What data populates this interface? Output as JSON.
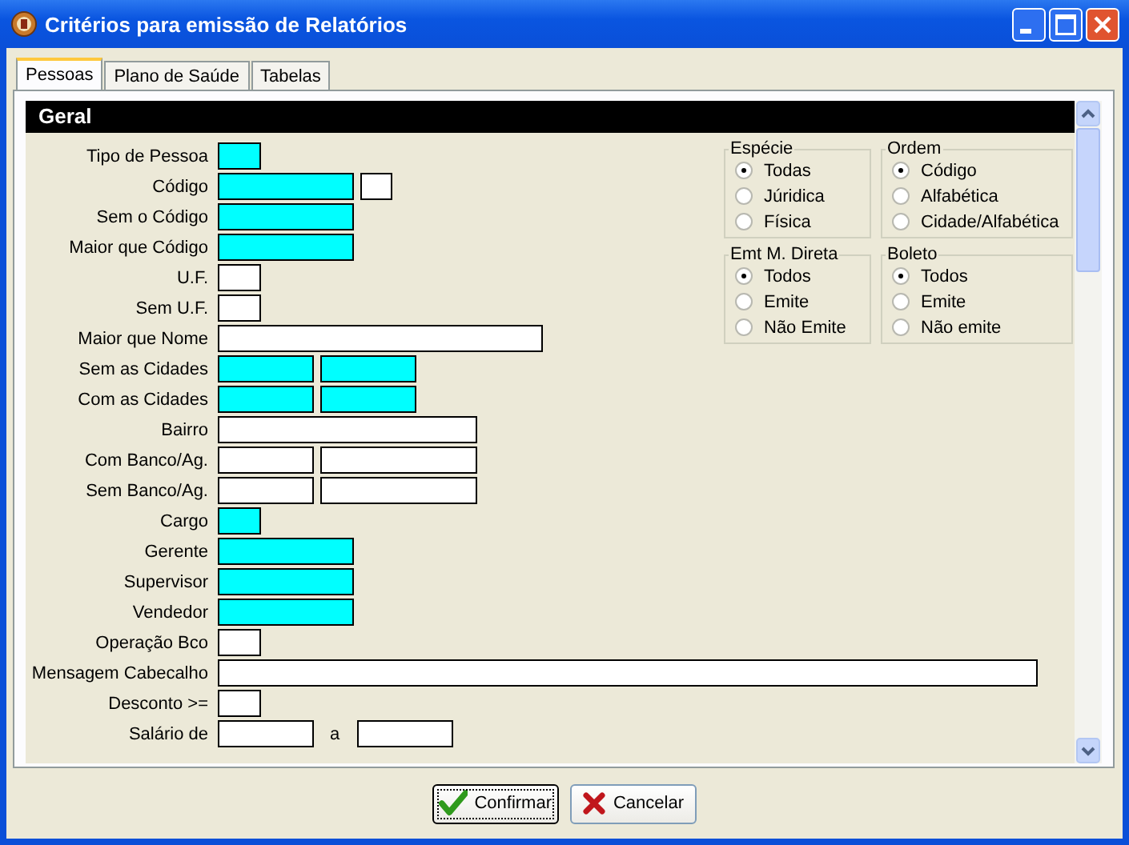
{
  "window": {
    "title": "Critérios para emissão de Relatórios"
  },
  "tabs": [
    {
      "label": "Pessoas",
      "selected": true
    },
    {
      "label": "Plano de Saúde",
      "selected": false
    },
    {
      "label": "Tabelas",
      "selected": false
    }
  ],
  "section": {
    "title": "Geral"
  },
  "rows": [
    {
      "label": "Tipo de Pessoa",
      "fields": [
        {
          "kind": "short",
          "color": "#00ffff"
        }
      ]
    },
    {
      "label": "Código",
      "fields": [
        {
          "kind": "code",
          "color": "#00ffff"
        },
        {
          "kind": "tiny",
          "color": "#ffffff"
        }
      ]
    },
    {
      "label": "Sem o Código",
      "fields": [
        {
          "kind": "code",
          "color": "#00ffff"
        }
      ]
    },
    {
      "label": "Maior que Código",
      "fields": [
        {
          "kind": "code",
          "color": "#00ffff"
        }
      ]
    },
    {
      "label": "U.F.",
      "fields": [
        {
          "kind": "short",
          "color": "#ffffff"
        }
      ]
    },
    {
      "label": "Sem U.F.",
      "fields": [
        {
          "kind": "short",
          "color": "#ffffff"
        }
      ]
    },
    {
      "label": "Maior que Nome",
      "fields": [
        {
          "kind": "long",
          "color": "#ffffff"
        }
      ]
    },
    {
      "label": "Sem as Cidades",
      "fields": [
        {
          "kind": "half",
          "color": "#00ffff"
        },
        {
          "kind": "half",
          "color": "#00ffff"
        }
      ]
    },
    {
      "label": "Com as Cidades",
      "fields": [
        {
          "kind": "half",
          "color": "#00ffff"
        },
        {
          "kind": "half",
          "color": "#00ffff"
        }
      ]
    },
    {
      "label": "Bairro",
      "fields": [
        {
          "kind": "mid",
          "color": "#ffffff"
        }
      ]
    },
    {
      "label": "Com Banco/Ag.",
      "fields": [
        {
          "kind": "half",
          "color": "#ffffff"
        },
        {
          "kind": "wide",
          "color": "#ffffff"
        }
      ]
    },
    {
      "label": "Sem Banco/Ag.",
      "fields": [
        {
          "kind": "half",
          "color": "#ffffff"
        },
        {
          "kind": "wide",
          "color": "#ffffff"
        }
      ]
    },
    {
      "label": "Cargo",
      "fields": [
        {
          "kind": "short",
          "color": "#00ffff"
        }
      ]
    },
    {
      "label": "Gerente",
      "fields": [
        {
          "kind": "code",
          "color": "#00ffff"
        }
      ]
    },
    {
      "label": "Supervisor",
      "fields": [
        {
          "kind": "code",
          "color": "#00ffff"
        }
      ]
    },
    {
      "label": "Vendedor",
      "fields": [
        {
          "kind": "code",
          "color": "#00ffff"
        }
      ]
    },
    {
      "label": "Operação Bco",
      "fields": [
        {
          "kind": "short",
          "color": "#ffffff"
        }
      ]
    },
    {
      "label": "Mensagem Cabecalho",
      "fields": [
        {
          "kind": "full",
          "color": "#ffffff"
        }
      ]
    },
    {
      "label": "Desconto >=",
      "fields": [
        {
          "kind": "short",
          "color": "#ffffff"
        }
      ]
    },
    {
      "label": "Salário de",
      "fields": [
        {
          "kind": "half",
          "color": "#ffffff"
        },
        {
          "kind": "text",
          "text": "a"
        },
        {
          "kind": "half",
          "color": "#ffffff"
        }
      ]
    }
  ],
  "groups": [
    {
      "title": "Espécie",
      "options": [
        {
          "label": "Todas",
          "selected": true
        },
        {
          "label": "Júridica",
          "selected": false
        },
        {
          "label": "Física",
          "selected": false
        }
      ]
    },
    {
      "title": "Ordem",
      "options": [
        {
          "label": "Código",
          "selected": true
        },
        {
          "label": "Alfabética",
          "selected": false
        },
        {
          "label": "Cidade/Alfabética",
          "selected": false
        }
      ]
    },
    {
      "title": "Emt M. Direta",
      "options": [
        {
          "label": "Todos",
          "selected": true
        },
        {
          "label": "Emite",
          "selected": false
        },
        {
          "label": "Não Emite",
          "selected": false
        }
      ]
    },
    {
      "title": "Boleto",
      "options": [
        {
          "label": "Todos",
          "selected": true
        },
        {
          "label": "Emite",
          "selected": false
        },
        {
          "label": "Não emite",
          "selected": false
        }
      ]
    }
  ],
  "buttons": [
    {
      "label": "Confirmar",
      "kind": "confirm"
    },
    {
      "label": "Cancelar",
      "kind": "cancel"
    }
  ]
}
